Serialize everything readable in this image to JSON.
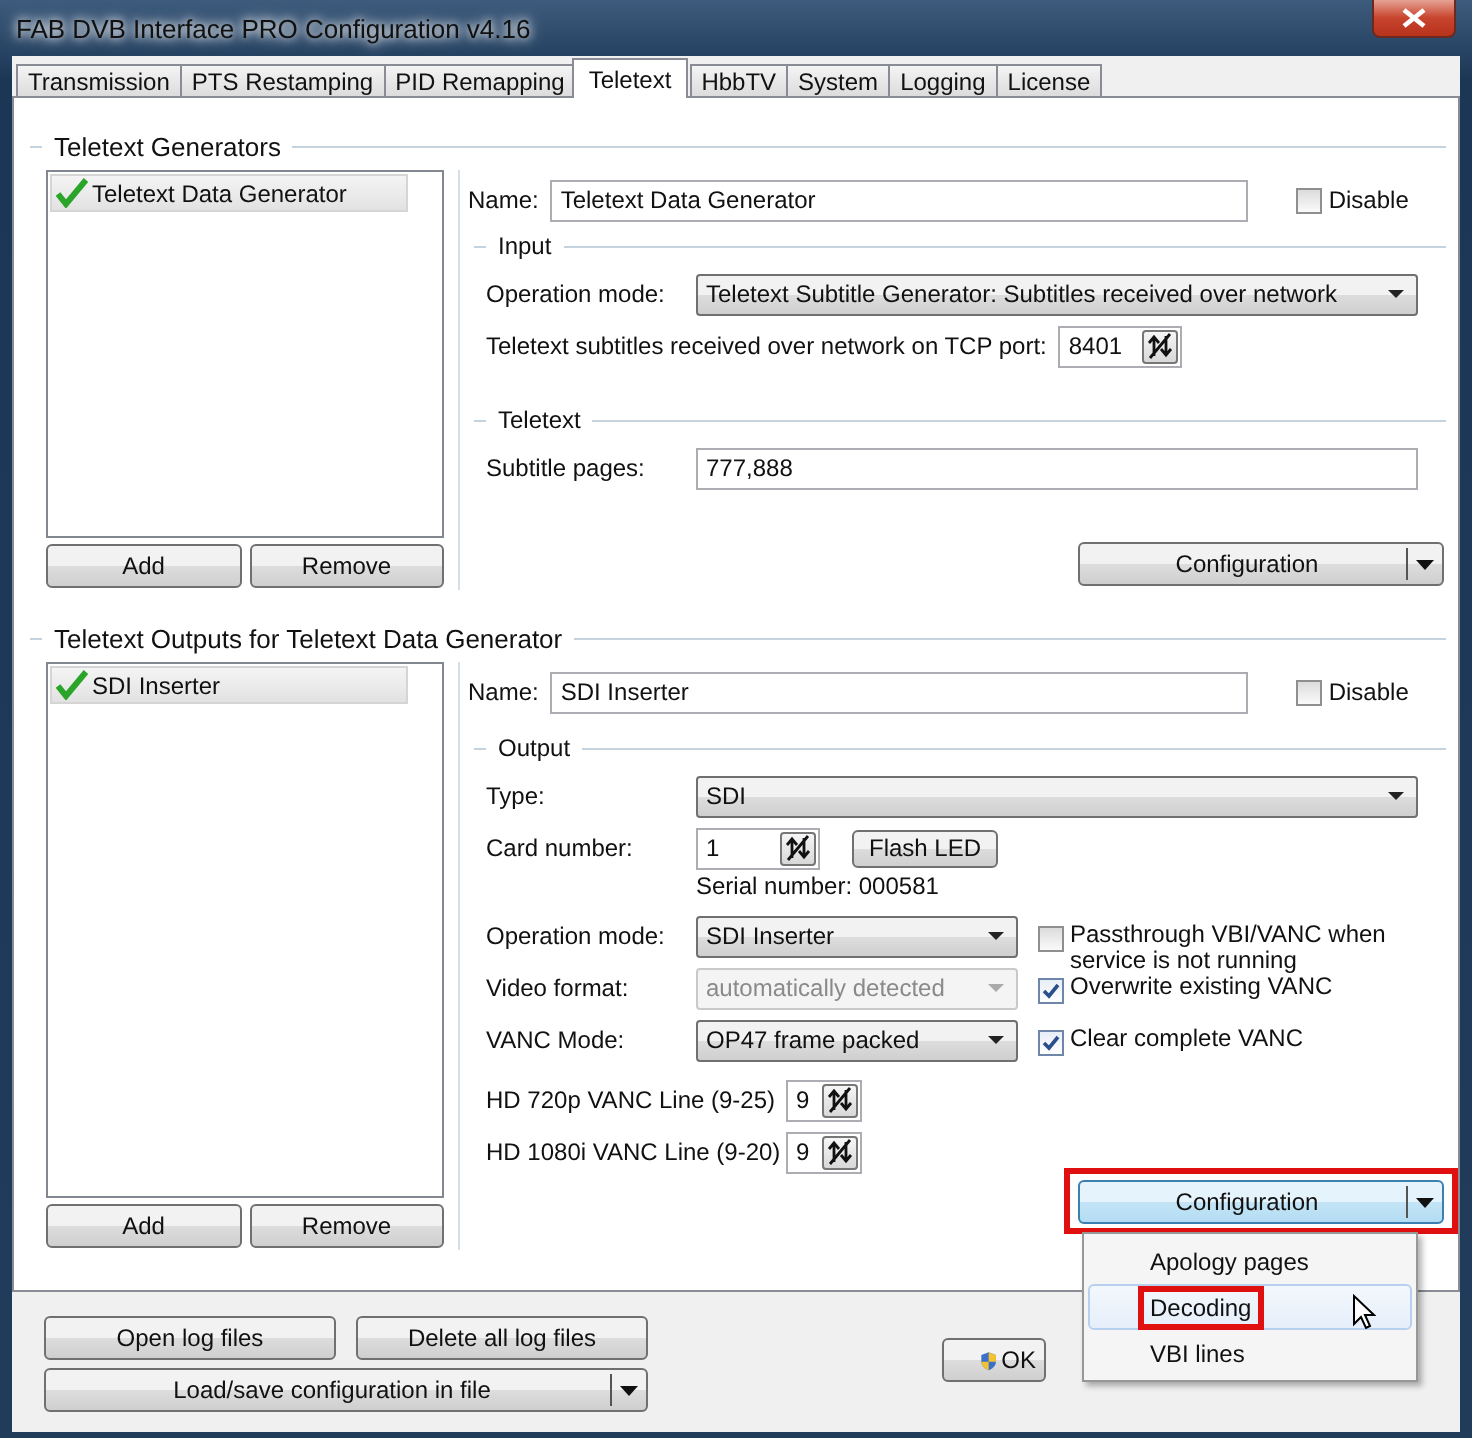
{
  "window": {
    "title": "FAB DVB Interface PRO Configuration v4.16"
  },
  "tabs": [
    {
      "label": "Transmission",
      "selected": false
    },
    {
      "label": "PTS Restamping",
      "selected": false
    },
    {
      "label": "PID Remapping",
      "selected": false
    },
    {
      "label": "Teletext",
      "selected": true
    },
    {
      "label": "HbbTV",
      "selected": false
    },
    {
      "label": "System",
      "selected": false
    },
    {
      "label": "Logging",
      "selected": false
    },
    {
      "label": "License",
      "selected": false
    }
  ],
  "generators": {
    "heading": "Teletext Generators",
    "items": [
      {
        "label": "Teletext Data Generator",
        "checked": true,
        "selected": true
      }
    ],
    "buttons": [
      "Add",
      "Remove"
    ],
    "form": {
      "name_label": "Name:",
      "name": "Teletext Data Generator",
      "disable": {
        "label": "Disable",
        "checked": false
      },
      "input": {
        "heading": "Input",
        "operation_mode_label": "Operation mode:",
        "operation_mode": "Teletext Subtitle Generator: Subtitles received over network",
        "port_label": "Teletext subtitles received over network on TCP port:",
        "port": "8401"
      },
      "teletext": {
        "heading": "Teletext",
        "pages_label": "Subtitle pages:",
        "pages": "777,888"
      },
      "configuration": {
        "label": "Configuration",
        "expanded": false
      }
    }
  },
  "outputs": {
    "heading": "Teletext Outputs for Teletext Data Generator",
    "items": [
      {
        "label": "SDI Inserter",
        "checked": true,
        "selected": true
      }
    ],
    "buttons": [
      "Add",
      "Remove"
    ],
    "form": {
      "name_label": "Name:",
      "name": "SDI Inserter",
      "disable": {
        "label": "Disable",
        "checked": false
      },
      "output": {
        "heading": "Output",
        "type": {
          "label": "Type:",
          "value": "SDI"
        },
        "card": {
          "label": "Card number:",
          "value": "1",
          "button": "Flash LED",
          "serial": "Serial number: 000581"
        },
        "operation_mode": {
          "label": "Operation mode:",
          "value": "SDI Inserter",
          "disabled": false
        },
        "video_format": {
          "label": "Video format:",
          "value": "automatically detected",
          "disabled": true
        },
        "vanc_mode": {
          "label": "VANC Mode:",
          "value": "OP47 frame packed",
          "disabled": false
        },
        "options": [
          {
            "label": "Passthrough VBI/VANC when service is not running",
            "checked": false
          },
          {
            "label": "Overwrite existing VANC",
            "checked": true
          },
          {
            "label": "Clear complete VANC",
            "checked": true
          }
        ],
        "hd720": {
          "label": "HD 720p VANC Line (9-25)",
          "value": "9"
        },
        "hd1080": {
          "label": "HD 1080i VANC Line (9-20)",
          "value": "9"
        }
      },
      "configuration": {
        "label": "Configuration",
        "annotated": true,
        "expanded": true,
        "menu": [
          {
            "label": "Apology pages",
            "hovered": false,
            "annotated": false
          },
          {
            "label": "Decoding",
            "hovered": true,
            "annotated": true
          },
          {
            "label": "VBI lines",
            "hovered": false,
            "annotated": false
          }
        ]
      }
    }
  },
  "bottom": {
    "buttons": [
      "Open log files",
      "Delete all log files"
    ],
    "load_save": "Load/save configuration in file",
    "ok": "OK"
  }
}
